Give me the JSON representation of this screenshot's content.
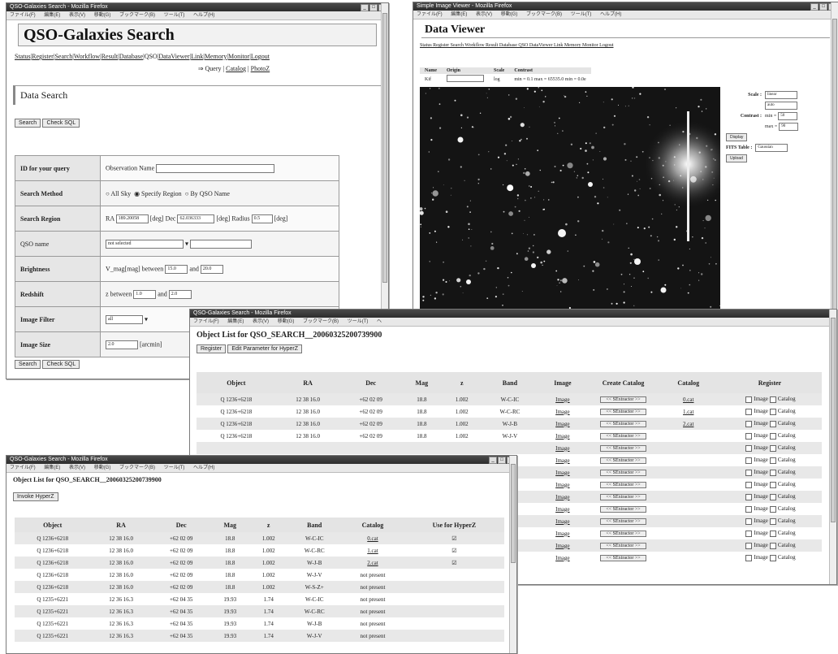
{
  "w1": {
    "title": "QSO-Galaxies Search - Mozilla Firefox",
    "menu": [
      "ファイル(F)",
      "編集(E)",
      "表示(V)",
      "移動(G)",
      "ブックマーク(B)",
      "ツール(T)",
      "ヘルプ(H)"
    ],
    "page_title": "QSO-Galaxies Search",
    "nav": [
      "Status",
      "Register",
      "Search",
      "Workflow",
      "Result",
      "Database",
      "QSO",
      "DataViewer",
      "Link",
      "Memory",
      "Monitor",
      "Logout"
    ],
    "subnav": [
      "Query",
      "Catalog",
      "PhotoZ"
    ],
    "subnav_arrow": "⇒",
    "section": "Data Search",
    "btn_search": "Search",
    "btn_check": "Check SQL",
    "rows": {
      "id_label": "ID for your query",
      "id_text": "Observation Name",
      "method_label": "Search Method",
      "method_opts": [
        "All Sky",
        "Specify Region",
        "By QSO Name"
      ],
      "region_label": "Search Region",
      "ra_label": "RA",
      "ra_value": "189.20058",
      "deg": "[deg]",
      "dec_label": "Dec",
      "dec_value": "62.036333",
      "radius_label": "Radius",
      "radius_value": "0.5",
      "qso_label": "QSO name",
      "qso_select": "not selected",
      "bright_label": "Brightness",
      "bright_text": "V_mag[mag]",
      "between": "between",
      "and": "and",
      "bright_min": "15.0",
      "bright_max": "20.0",
      "redshift_label": "Redshift",
      "redshift_text": "z",
      "z_min": "1.0",
      "z_max": "2.0",
      "filter_label": "Image Filter",
      "filter_value": "all",
      "size_label": "Image Size",
      "size_value": "2.0",
      "arcmin": "[arcmin]"
    }
  },
  "w2": {
    "title": "Simple Image Viewer - Mozilla Firefox",
    "menu": [
      "ファイル(F)",
      "編集(E)",
      "表示(V)",
      "移動(G)",
      "ブックマーク(B)",
      "ツール(T)",
      "ヘルプ(H)"
    ],
    "page_title": "Data Viewer",
    "nav": "Status Register Search Workflow Result Database QSO DataViewer Link Memory Monitor Logout",
    "info_headers": [
      "Name",
      "Origin",
      "Scale",
      "Contrast"
    ],
    "info_values": [
      "Kif",
      "",
      "log",
      "min = 0.1 max = 65535.0 min = 0.0e"
    ],
    "ctl": {
      "scale_label": "Scale :",
      "scale_value": "linear",
      "contrast_label": "Contrast :",
      "contrast_mode": "auto",
      "min_label": "min =",
      "min_value": "50",
      "max_label": "max =",
      "max_value": "90",
      "display_btn": "Display",
      "fits_label": "FITS Table :",
      "fits_value": "Gaussian",
      "upload_btn": "Upload"
    }
  },
  "w3": {
    "title": "QSO-Galaxies Search - Mozilla Firefox",
    "menu": [
      "ファイル(F)",
      "編集(E)",
      "表示(V)",
      "移動(G)",
      "ブックマーク(B)",
      "ツール(T)",
      "ヘ"
    ],
    "heading": "Object List for QSO_SEARCH__20060325200739900",
    "btn_register": "Register",
    "btn_edit": "Edit Parameter for HyperZ",
    "headers": [
      "Object",
      "RA",
      "Dec",
      "Mag",
      "z",
      "Band",
      "Image",
      "Create Catalog",
      "Catalog",
      "Register"
    ],
    "rows": [
      [
        "Q 1236+6218",
        "12 38 16.0",
        "+62 02 09",
        "18.8",
        "1.002",
        "W-C-IC",
        "Image",
        "<< SExtractor >>",
        "0.cat"
      ],
      [
        "Q 1236+6218",
        "12 38 16.0",
        "+62 02 09",
        "18.8",
        "1.002",
        "W-C-RC",
        "Image",
        "<< SExtractor >>",
        "1.cat"
      ],
      [
        "Q 1236+6218",
        "12 38 16.0",
        "+62 02 09",
        "18.8",
        "1.002",
        "W-J-B",
        "Image",
        "<< SExtractor >>",
        "2.cat"
      ],
      [
        "Q 1236+6218",
        "12 38 16.0",
        "+62 02 09",
        "18.8",
        "1.002",
        "W-J-V",
        "Image",
        "<< SExtractor >>",
        ""
      ],
      [
        "",
        "",
        "",
        "",
        "",
        "",
        "Image",
        "<< SExtractor >>",
        ""
      ],
      [
        "",
        "",
        "",
        "",
        "",
        "",
        "Image",
        "<< SExtractor >>",
        ""
      ],
      [
        "",
        "",
        "",
        "",
        "",
        "",
        "Image",
        "<< SExtractor >>",
        ""
      ],
      [
        "",
        "",
        "",
        "",
        "",
        "",
        "Image",
        "<< SExtractor >>",
        ""
      ],
      [
        "",
        "",
        "",
        "",
        "",
        "",
        "Image",
        "<< SExtractor >>",
        ""
      ],
      [
        "",
        "",
        "",
        "",
        "",
        "",
        "Image",
        "<< SExtractor >>",
        ""
      ],
      [
        "",
        "",
        "",
        "",
        "",
        "",
        "Image",
        "<< SExtractor >>",
        ""
      ],
      [
        "",
        "",
        "",
        "",
        "",
        "",
        "Image",
        "<< SExtractor >>",
        ""
      ],
      [
        "",
        "",
        "",
        "",
        "",
        "",
        "Image",
        "<< SExtractor >>",
        ""
      ],
      [
        "",
        "",
        "",
        "",
        "",
        "",
        "Image",
        "<< SExtractor >>",
        ""
      ]
    ],
    "reg_image": "Image",
    "reg_catalog": "Catalog"
  },
  "w4": {
    "title": "QSO-Galaxies Search - Mozilla Firefox",
    "menu": [
      "ファイル(F)",
      "編集(E)",
      "表示(V)",
      "移動(G)",
      "ブックマーク(B)",
      "ツール(T)",
      "ヘルプ(H)"
    ],
    "heading": "Object List for QSO_SEARCH__20060325200739900",
    "btn_invoke": "Invoke HyperZ",
    "headers": [
      "Object",
      "RA",
      "Dec",
      "Mag",
      "z",
      "Band",
      "Catalog",
      "Use for HyperZ"
    ],
    "rows": [
      [
        "Q 1236+6218",
        "12 38 16.0",
        "+62 02 09",
        "18.8",
        "1.002",
        "W-C-IC",
        "0.cat",
        "☑"
      ],
      [
        "Q 1236+6218",
        "12 38 16.0",
        "+62 02 09",
        "18.8",
        "1.002",
        "W-C-RC",
        "1.cat",
        "☑"
      ],
      [
        "Q 1236+6218",
        "12 38 16.0",
        "+62 02 09",
        "18.8",
        "1.002",
        "W-J-B",
        "2.cat",
        "☑"
      ],
      [
        "Q 1236+6218",
        "12 38 16.0",
        "+62 02 09",
        "18.8",
        "1.002",
        "W-J-V",
        "not present",
        ""
      ],
      [
        "Q 1236+6218",
        "12 38 16.0",
        "+62 02 09",
        "18.8",
        "1.002",
        "W-S-Z+",
        "not present",
        ""
      ],
      [
        "Q 1235+6221",
        "12 36 16.3",
        "+62 04 35",
        "19.93",
        "1.74",
        "W-C-IC",
        "not present",
        ""
      ],
      [
        "Q 1235+6221",
        "12 36 16.3",
        "+62 04 35",
        "19.93",
        "1.74",
        "W-C-RC",
        "not present",
        ""
      ],
      [
        "Q 1235+6221",
        "12 36 16.3",
        "+62 04 35",
        "19.93",
        "1.74",
        "W-J-B",
        "not present",
        ""
      ],
      [
        "Q 1235+6221",
        "12 36 16.3",
        "+62 04 35",
        "19.93",
        "1.74",
        "W-J-V",
        "not present",
        ""
      ]
    ]
  }
}
